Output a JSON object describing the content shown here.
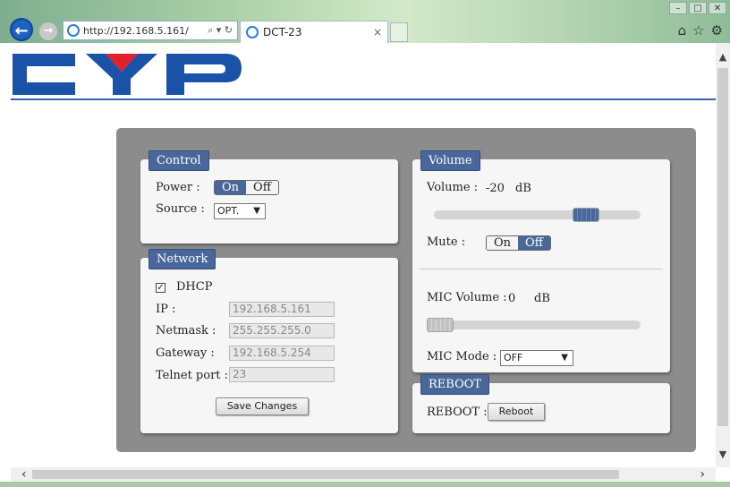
{
  "browser": {
    "url": "http://192.168.5.161/",
    "address_tools": "⌕ ▾ ↻",
    "tab_title": "DCT-23",
    "tab_close": "×",
    "back": "←",
    "forward": "→",
    "win_minimize": "–",
    "win_maximize": "□",
    "win_close": "✕",
    "home_icon": "⌂",
    "star_icon": "☆",
    "gear_icon": "⚙"
  },
  "logo": {
    "text": "CYP",
    "color": "#1a52a8",
    "accent": "#e0202a"
  },
  "control": {
    "legend": "Control",
    "power_label": "Power :",
    "power_on": "On",
    "power_off": "Off",
    "power_state": "On",
    "source_label": "Source :",
    "source_value": "OPT."
  },
  "network": {
    "legend": "Network",
    "dhcp_label": "DHCP",
    "dhcp_checked": true,
    "dhcp_mark": "✓",
    "ip_label": "IP :",
    "ip_value": "192.168.5.161",
    "netmask_label": "Netmask :",
    "netmask_value": "255.255.255.0",
    "gateway_label": "Gateway :",
    "gateway_value": "192.168.5.254",
    "telnet_label": "Telnet port :",
    "telnet_value": "23",
    "save_button": "Save Changes"
  },
  "volume": {
    "legend": "Volume",
    "volume_label": "Volume :",
    "volume_value": "-20",
    "volume_unit": "dB",
    "volume_level": 0.77,
    "mute_label": "Mute :",
    "mute_on": "On",
    "mute_off": "Off",
    "mute_state": "Off",
    "mic_volume_label": "MIC Volume :",
    "mic_volume_value": "0",
    "mic_volume_unit": "dB",
    "mic_level": 0.0,
    "mic_mode_label": "MIC Mode :",
    "mic_mode_value": "OFF"
  },
  "reboot": {
    "legend": "REBOOT",
    "label": "REBOOT :",
    "button": "Reboot"
  },
  "colors": {
    "accent": "#4a679b",
    "panel": "#8c8c8c",
    "rule": "#3b5fb8"
  }
}
